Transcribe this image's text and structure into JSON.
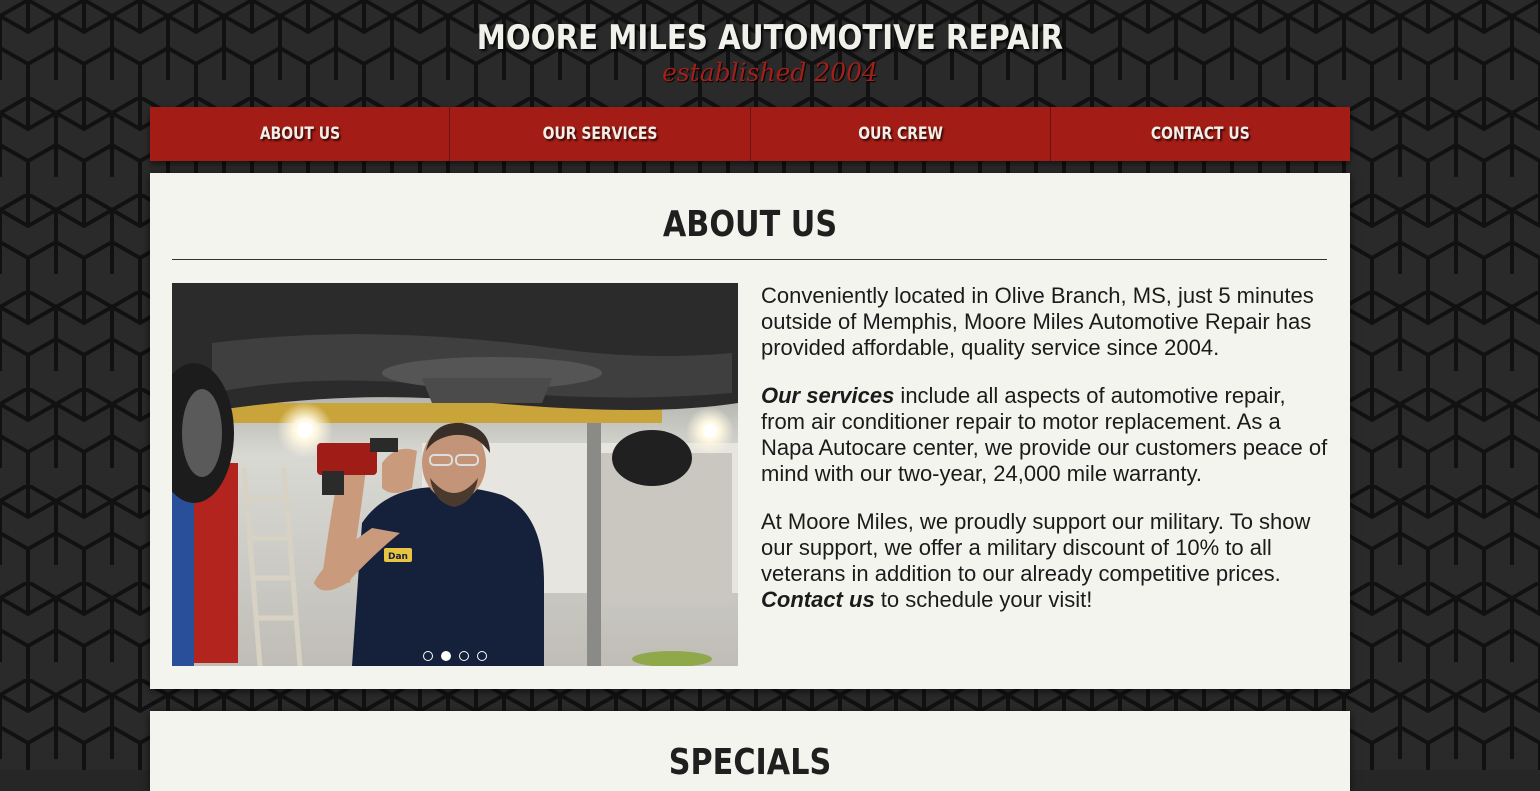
{
  "header": {
    "title": "MOORE MILES AUTOMOTIVE REPAIR",
    "tagline": "established 2004"
  },
  "nav": {
    "items": [
      {
        "label": "ABOUT US"
      },
      {
        "label": "OUR SERVICES"
      },
      {
        "label": "OUR CREW"
      },
      {
        "label": "CONTACT US"
      }
    ]
  },
  "about": {
    "heading": "ABOUT US",
    "paragraph1": "Conveniently located in Olive Branch, MS, just 5 minutes outside of Memphis, Moore Miles Automotive Repair has provided affordable, quality service since 2004.",
    "paragraph2_link": "Our services",
    "paragraph2_rest": " include all aspects of automotive repair, from air conditioner repair to motor replacement. As a Napa Autocare center, we provide our customers peace of mind with our two-year, 24,000 mile warranty.",
    "paragraph3_start": "At Moore Miles, we proudly support our military. To show our support, we offer a military discount of 10% to all veterans in addition to our already competitive prices. ",
    "paragraph3_link": "Contact us",
    "paragraph3_end": " to schedule your visit!",
    "slideshow": {
      "slide_count": 4,
      "active_slide": 2,
      "badge_text": "Dan"
    }
  },
  "specials": {
    "heading": "SPECIALS"
  },
  "colors": {
    "brand_red": "#a31d16",
    "background": "#262626",
    "panel": "#f4f4ef",
    "text": "#1b1b1b"
  }
}
